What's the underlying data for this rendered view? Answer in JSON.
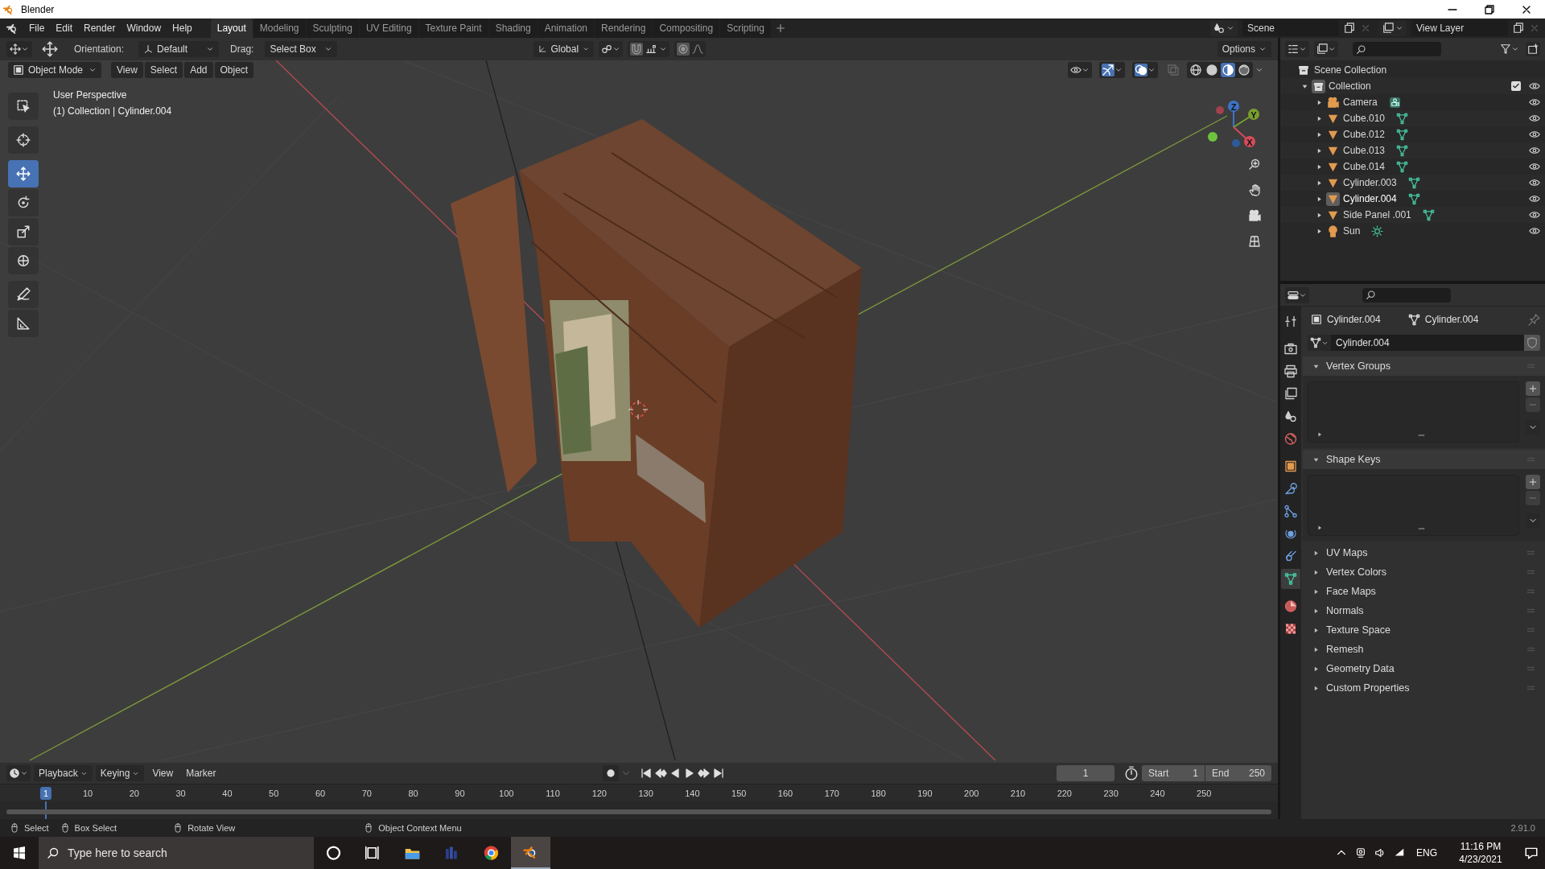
{
  "window": {
    "title": "Blender"
  },
  "menu": [
    "File",
    "Edit",
    "Render",
    "Window",
    "Help"
  ],
  "workspaces": [
    {
      "label": "Layout",
      "selected": true
    },
    {
      "label": "Modeling",
      "selected": false
    },
    {
      "label": "Sculpting",
      "selected": false
    },
    {
      "label": "UV Editing",
      "selected": false
    },
    {
      "label": "Texture Paint",
      "selected": false
    },
    {
      "label": "Shading",
      "selected": false
    },
    {
      "label": "Animation",
      "selected": false
    },
    {
      "label": "Rendering",
      "selected": false
    },
    {
      "label": "Compositing",
      "selected": false
    },
    {
      "label": "Scripting",
      "selected": false
    }
  ],
  "scene": {
    "name": "Scene",
    "view_layer": "View Layer"
  },
  "tool_header": {
    "orientation_label": "Orientation:",
    "orientation": "Default",
    "drag_label": "Drag:",
    "drag": "Select Box",
    "transform": "Global",
    "options": "Options",
    "snap": false,
    "proportional_edit": false
  },
  "viewport": {
    "mode": "Object Mode",
    "menus": [
      "View",
      "Select",
      "Add",
      "Object"
    ],
    "info": [
      "User Perspective",
      "(1) Collection | Cylinder.004"
    ],
    "tools": [
      {
        "kind": "select",
        "selected": false
      },
      {
        "kind": "cursor",
        "selected": false
      },
      {
        "kind": "move",
        "selected": true
      },
      {
        "kind": "rotate",
        "selected": false
      },
      {
        "kind": "scale",
        "selected": false
      },
      {
        "kind": "transform",
        "selected": false
      },
      {
        "kind": "annotate",
        "selected": false
      },
      {
        "kind": "measure",
        "selected": false
      }
    ],
    "shading": [
      {
        "kind": "wireframe",
        "selected": false
      },
      {
        "kind": "solid",
        "selected": false
      },
      {
        "kind": "material",
        "selected": true
      },
      {
        "kind": "rendered",
        "selected": false
      }
    ],
    "gizmo": [
      "Z",
      "Y",
      "X"
    ],
    "gizmos_on": true,
    "overlays_on": true
  },
  "outliner": {
    "root": "Scene Collection",
    "collection": {
      "label": "Collection",
      "checked": true,
      "expanded": true,
      "children": [
        {
          "label": "Camera",
          "kind": "camera",
          "selected": false
        },
        {
          "label": "Cube.010",
          "kind": "mesh",
          "selected": false
        },
        {
          "label": "Cube.012",
          "kind": "mesh",
          "selected": false
        },
        {
          "label": "Cube.013",
          "kind": "mesh",
          "selected": false
        },
        {
          "label": "Cube.014",
          "kind": "mesh",
          "selected": false
        },
        {
          "label": "Cylinder.003",
          "kind": "mesh",
          "selected": false
        },
        {
          "label": "Cylinder.004",
          "kind": "mesh",
          "selected": true
        },
        {
          "label": "Side Panel .001",
          "kind": "mesh",
          "selected": false
        },
        {
          "label": "Sun",
          "kind": "light",
          "selected": false
        }
      ]
    }
  },
  "properties": {
    "object": "Cylinder.004",
    "data": "Cylinder.004",
    "mesh_name": "Cylinder.004",
    "tabs": [
      {
        "kind": "tool",
        "selected": false
      },
      {
        "kind": "render",
        "selected": false
      },
      {
        "kind": "output",
        "selected": false
      },
      {
        "kind": "view_layer",
        "selected": false
      },
      {
        "kind": "scene",
        "selected": false
      },
      {
        "kind": "world",
        "selected": false
      },
      {
        "kind": "object",
        "selected": false
      },
      {
        "kind": "modifier",
        "selected": false
      },
      {
        "kind": "particles",
        "selected": false
      },
      {
        "kind": "physics",
        "selected": false
      },
      {
        "kind": "constraints",
        "selected": false
      },
      {
        "kind": "data",
        "selected": true
      },
      {
        "kind": "material",
        "selected": false
      },
      {
        "kind": "texture",
        "selected": false
      }
    ],
    "panels": [
      {
        "label": "Vertex Groups",
        "expanded": true
      },
      {
        "label": "Shape Keys",
        "expanded": true
      },
      {
        "label": "UV Maps",
        "expanded": false
      },
      {
        "label": "Vertex Colors",
        "expanded": false
      },
      {
        "label": "Face Maps",
        "expanded": false
      },
      {
        "label": "Normals",
        "expanded": false
      },
      {
        "label": "Texture Space",
        "expanded": false
      },
      {
        "label": "Remesh",
        "expanded": false
      },
      {
        "label": "Geometry Data",
        "expanded": false
      },
      {
        "label": "Custom Properties",
        "expanded": false
      }
    ]
  },
  "timeline": {
    "menus": [
      "Playback",
      "Keying",
      "View",
      "Marker"
    ],
    "current": "1",
    "start_label": "Start",
    "start": "1",
    "end_label": "End",
    "end": "250",
    "frames": [
      {
        "label": "1",
        "selected": true
      },
      {
        "label": "10",
        "selected": false
      },
      {
        "label": "20",
        "selected": false
      },
      {
        "label": "30",
        "selected": false
      },
      {
        "label": "40",
        "selected": false
      },
      {
        "label": "50",
        "selected": false
      },
      {
        "label": "60",
        "selected": false
      },
      {
        "label": "70",
        "selected": false
      },
      {
        "label": "80",
        "selected": false
      },
      {
        "label": "90",
        "selected": false
      },
      {
        "label": "100",
        "selected": false
      },
      {
        "label": "110",
        "selected": false
      },
      {
        "label": "120",
        "selected": false
      },
      {
        "label": "130",
        "selected": false
      },
      {
        "label": "140",
        "selected": false
      },
      {
        "label": "150",
        "selected": false
      },
      {
        "label": "160",
        "selected": false
      },
      {
        "label": "170",
        "selected": false
      },
      {
        "label": "180",
        "selected": false
      },
      {
        "label": "190",
        "selected": false
      },
      {
        "label": "200",
        "selected": false
      },
      {
        "label": "210",
        "selected": false
      },
      {
        "label": "220",
        "selected": false
      },
      {
        "label": "230",
        "selected": false
      },
      {
        "label": "240",
        "selected": false
      },
      {
        "label": "250",
        "selected": false
      }
    ]
  },
  "status_bar": {
    "hints": [
      "Select",
      "Box Select",
      "Rotate View",
      "Object Context Menu"
    ],
    "version": "2.91.0"
  },
  "taskbar": {
    "search_placeholder": "Type here to search",
    "apps": [
      {
        "kind": "cortana",
        "selected": false
      },
      {
        "kind": "task_view",
        "selected": false
      },
      {
        "kind": "explorer",
        "selected": false
      },
      {
        "kind": "app",
        "selected": false
      },
      {
        "kind": "chrome",
        "selected": false
      },
      {
        "kind": "blender",
        "selected": true
      }
    ],
    "language": "ENG",
    "time": "11:16 PM",
    "date": "4/23/2021"
  }
}
